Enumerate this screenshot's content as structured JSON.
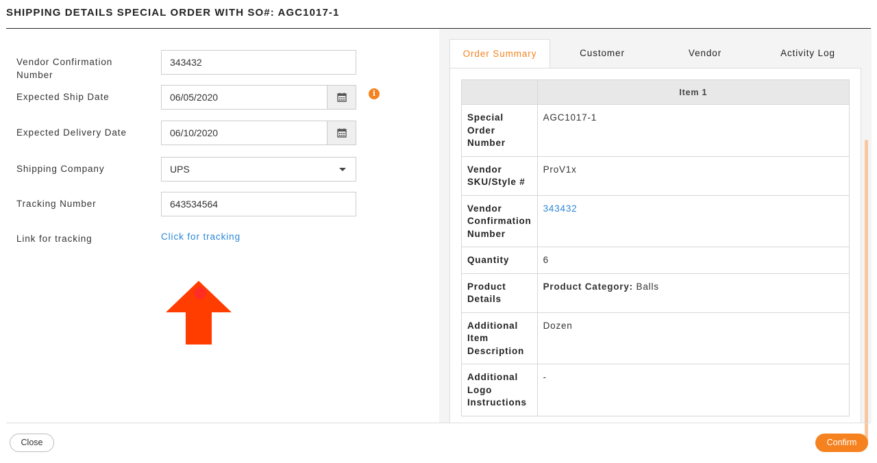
{
  "dialog": {
    "title": "SHIPPING DETAILS SPECIAL ORDER WITH SO#: AGC1017-1"
  },
  "form": {
    "vendor_confirmation": {
      "label": "Vendor Confirmation Number",
      "value": "343432"
    },
    "expected_ship_date": {
      "label": "Expected Ship Date",
      "value": "06/05/2020"
    },
    "expected_delivery_date": {
      "label": "Expected Delivery Date",
      "value": "06/10/2020"
    },
    "shipping_company": {
      "label": "Shipping Company",
      "value": "UPS"
    },
    "tracking_number": {
      "label": "Tracking Number",
      "value": "643534564"
    },
    "tracking_link": {
      "label": "Link for tracking",
      "text": "Click for tracking"
    }
  },
  "tabs": [
    {
      "label": "Order Summary",
      "active": true
    },
    {
      "label": "Customer",
      "active": false
    },
    {
      "label": "Vendor",
      "active": false
    },
    {
      "label": "Activity Log",
      "active": false
    }
  ],
  "summary": {
    "header": "Item 1",
    "rows": [
      {
        "key": "Special Order Number",
        "value": "AGC1017-1"
      },
      {
        "key": "Vendor SKU/Style #",
        "value": "ProV1x"
      },
      {
        "key": "Vendor Confirmation Number",
        "value": "343432"
      },
      {
        "key": "Quantity",
        "value": "6"
      },
      {
        "key": "Product Details",
        "value_label": "Product Category:",
        "value": "Balls"
      },
      {
        "key": "Additional Item Description",
        "value": "Dozen"
      },
      {
        "key": "Additional Logo Instructions",
        "value": "-"
      }
    ]
  },
  "footer": {
    "close_label": "Close",
    "confirm_label": "Confirm"
  },
  "colors": {
    "accent": "#f5821f",
    "link": "#2a86d8",
    "annotation_arrow": "#ff3d00"
  },
  "icons": [
    "calendar-icon",
    "info-icon",
    "chevron-down-icon",
    "arrow-up-annotation"
  ]
}
